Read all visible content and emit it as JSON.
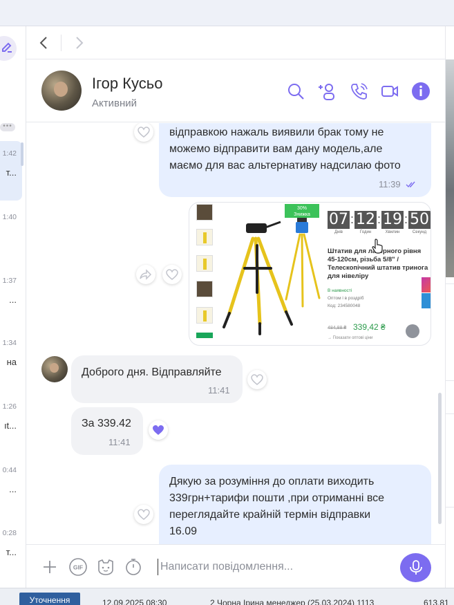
{
  "sidebar": {
    "compose_icon": "edit-icon",
    "rows": [
      {
        "time": "1:42",
        "snippet": "т..."
      },
      {
        "time": "1:40",
        "snippet": ""
      },
      {
        "time": "1:37",
        "snippet": "..."
      },
      {
        "time": "1:34",
        "snippet": "на"
      },
      {
        "time": "1:26",
        "snippet": "ıt..."
      },
      {
        "time": "0:44",
        "snippet": "..."
      },
      {
        "time": "0:28",
        "snippet": "т..."
      }
    ]
  },
  "header": {
    "name": "Ігор Кусьо",
    "status": "Активний",
    "icons": [
      "search-icon",
      "add-participant-icon",
      "call-icon",
      "video-call-icon",
      "info-icon"
    ]
  },
  "messages": [
    {
      "direction": "out",
      "text": "відправкою нажаль виявили брак тому не\nможемо відправити вам дану модель,але\nмаємо для вас альтернативу надсилаю фото",
      "time": "11:39"
    },
    {
      "direction": "out",
      "type": "image",
      "product": {
        "promo": "30%\nЗнижка",
        "timer": [
          {
            "value": "07",
            "label": "Днів"
          },
          {
            "value": "12",
            "label": "Годин"
          },
          {
            "value": "19",
            "label": "Хвилин"
          },
          {
            "value": "50",
            "label": "Секунд"
          }
        ],
        "title": "Штатив для лазерного рівня 45-120см, різьба 5/8\" / Телескопічний штатив тринога для нівеліру",
        "availability": "В наявності",
        "sale_type": "Оптом і в роздріб",
        "code": "Код: 234580048",
        "old_price": "484,88 ₴",
        "price": "339,42 ₴",
        "wholesale": "→ Показати оптові ціни"
      }
    },
    {
      "direction": "in",
      "text": "Доброго дня. Відправляйте",
      "time": "11:41"
    },
    {
      "direction": "in",
      "text": "За 339.42",
      "time": "11:41"
    },
    {
      "direction": "out",
      "text": "Дякую за розуміння до оплати виходить\n339грн+тарифи пошти ,при отриманні все\nпереглядайте крайній термін відправки\n16.09",
      "time": ""
    }
  ],
  "composer": {
    "placeholder": "Написати повідомлення...",
    "icons": [
      "plus-icon",
      "gif-icon",
      "sticker-icon",
      "timer-icon",
      "microphone-icon"
    ]
  },
  "bottom_bar": {
    "button": "Уточнення",
    "date": "12.09.2025 08:30",
    "info": "2 Чорна Ірина менеджер (25.03.2024) 1113",
    "amount": "613.81"
  }
}
